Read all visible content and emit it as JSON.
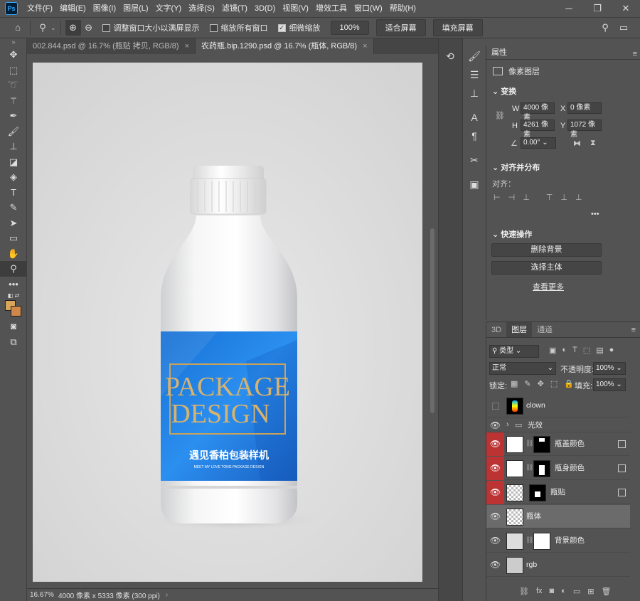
{
  "app": {
    "logo": "Ps"
  },
  "menu": [
    "文件(F)",
    "编辑(E)",
    "图像(I)",
    "图层(L)",
    "文字(Y)",
    "选择(S)",
    "滤镜(T)",
    "3D(D)",
    "视图(V)",
    "增效工具",
    "窗口(W)",
    "帮助(H)"
  ],
  "options": {
    "resize_windows": "调整窗口大小以满屏显示",
    "zoom_all": "缩放所有窗口",
    "scrubby_zoom": "细微缩放",
    "zoom_value": "100%",
    "fit_screen": "适合屏幕",
    "fill_screen": "填充屏幕"
  },
  "tabs": [
    {
      "label": "002.844.psd @ 16.7% (瓶贴 拷贝, RGB/8)",
      "active": false
    },
    {
      "label": "农药瓶.bip.1290.psd @ 16.7% (瓶体, RGB/8)",
      "active": true
    }
  ],
  "document": {
    "label_line1": "PACKAGE",
    "label_line2": "DESIGN",
    "label_cn": "遇见香柏包装样机",
    "label_small": "MEET MY LOVE TONG PACKAGE DESIGN"
  },
  "status": {
    "zoom": "16.67%",
    "info": "4000 像素 x 5333 像素 (300 ppi)"
  },
  "properties": {
    "tab": "属性",
    "type": "像素图层",
    "transform_title": "变换",
    "w_label": "W",
    "w": "4000 像素",
    "h_label": "H",
    "h": "4261 像素",
    "x_label": "X",
    "x": "0 像素",
    "y_label": "Y",
    "y": "1072 像素",
    "angle": "0.00°",
    "align_title": "对齐并分布",
    "align_label": "对齐：",
    "quick_title": "快速操作",
    "remove_bg": "删除背景",
    "select_subject": "选择主体",
    "see_more": "查看更多"
  },
  "layers_panel": {
    "tabs": [
      "3D",
      "图层",
      "通道"
    ],
    "filter": "类型",
    "blend": "正常",
    "opacity_label": "不透明度:",
    "opacity": "100%",
    "lock_label": "锁定:",
    "fill_label": "填充:",
    "fill": "100%",
    "layers": [
      {
        "name": "clown",
        "visible": false
      },
      {
        "name": "光效",
        "visible": true,
        "group": true
      },
      {
        "name": "瓶盖颜色",
        "visible": true
      },
      {
        "name": "瓶身颜色",
        "visible": true
      },
      {
        "name": "瓶贴",
        "visible": true
      },
      {
        "name": "瓶体",
        "visible": true,
        "selected": true
      },
      {
        "name": "背景颜色",
        "visible": true
      },
      {
        "name": "rgb",
        "visible": true
      }
    ]
  },
  "colors": {
    "accent_red": "#b33333",
    "label_blue": "#1e7ad6",
    "gold": "#c9a35a",
    "fg_swatch": "#d9a55a",
    "bg_swatch": "#d0884a"
  }
}
